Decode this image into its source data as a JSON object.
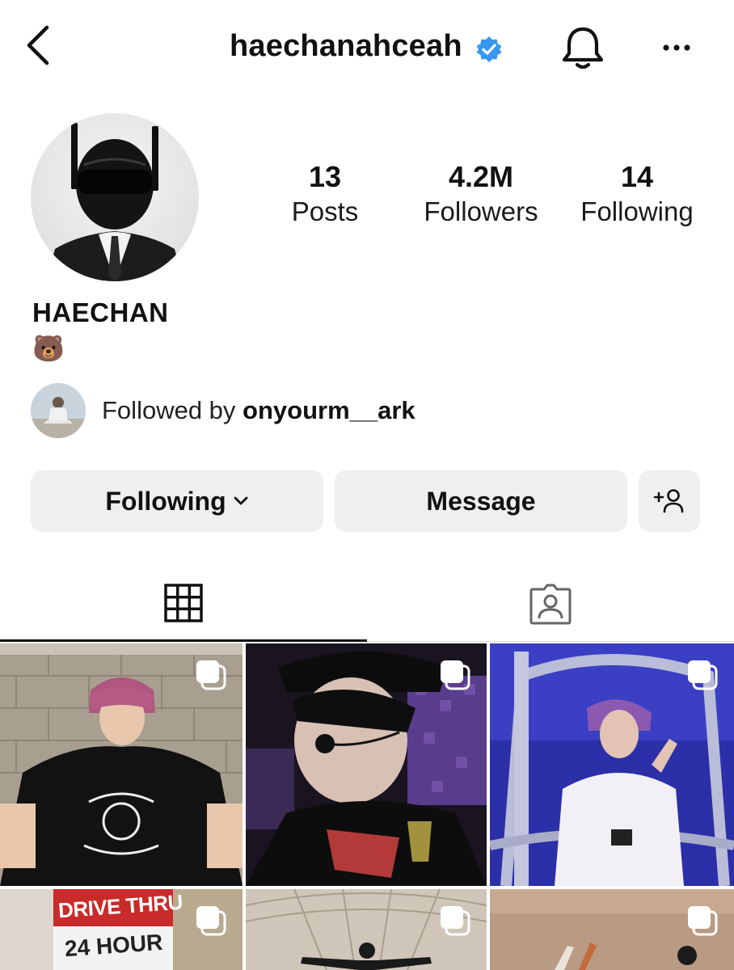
{
  "header": {
    "username": "haechanahceah",
    "verified": true,
    "icons": [
      "back-chevron-icon",
      "verified-badge-icon",
      "bell-icon",
      "more-dots-icon"
    ]
  },
  "profile": {
    "stats": [
      {
        "value": "13",
        "label": "Posts"
      },
      {
        "value": "4.2M",
        "label": "Followers"
      },
      {
        "value": "14",
        "label": "Following"
      }
    ],
    "full_name": "HAECHAN",
    "bio": "🐻",
    "followed_by_prefix": "Followed by ",
    "followed_by_user": "onyourm__ark"
  },
  "actions": {
    "following_label": "Following",
    "message_label": "Message",
    "add_friend_icon": "add-person-icon"
  },
  "tabs": [
    {
      "name": "posts-grid",
      "icon": "grid-icon",
      "active": true
    },
    {
      "name": "tagged",
      "icon": "tagged-person-icon",
      "active": false
    }
  ],
  "posts": [
    {
      "multi": true
    },
    {
      "multi": true
    },
    {
      "multi": true
    },
    {
      "multi": true,
      "text_line1": "DRIVE THRU",
      "text_line2": "24 HOUR"
    },
    {
      "multi": true
    },
    {
      "multi": true
    }
  ],
  "colors": {
    "verified": "#3897f0",
    "button_bg": "#efefef",
    "text": "#111111"
  }
}
